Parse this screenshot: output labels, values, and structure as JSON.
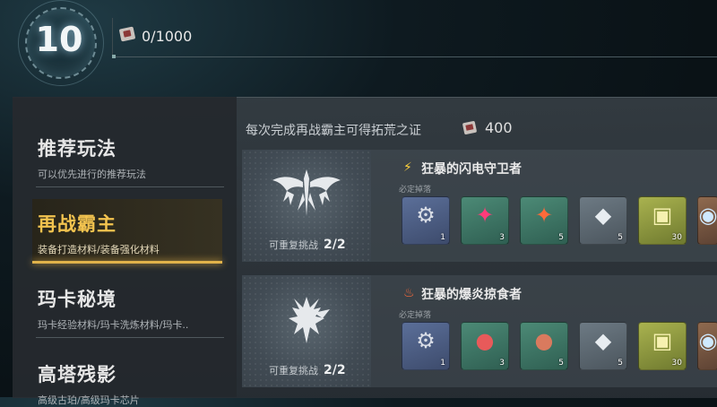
{
  "header": {
    "level": "10",
    "ticket_count": "0/1000"
  },
  "sidebar": {
    "items": [
      {
        "title": "推荐玩法",
        "subtitle": "可以优先进行的推荐玩法"
      },
      {
        "title": "再战霸主",
        "subtitle": "装备打造材料/装备强化材料"
      },
      {
        "title": "玛卡秘境",
        "subtitle": "玛卡经验材料/玛卡洗炼材料/玛卡.."
      },
      {
        "title": "高塔残影",
        "subtitle": "高级古珀/高级玛卡芯片"
      }
    ],
    "active_index": 1
  },
  "main": {
    "reward_info": "每次完成再战霸主可得拓荒之证",
    "reward_amount": "400",
    "bosses": [
      {
        "name": "狂暴的闪电守卫者",
        "element_icon": "lightning-icon",
        "drop_label": "必定掉落",
        "retry_label": "可重复挑战",
        "retry_value": "2/2",
        "drops": [
          {
            "icon": "claw-gear-icon",
            "quality": "blue",
            "qty": "1"
          },
          {
            "icon": "crystal-icon",
            "quality": "green",
            "qty": "3"
          },
          {
            "icon": "crystal-icon",
            "quality": "green",
            "qty": "5"
          },
          {
            "icon": "ore-icon",
            "quality": "gray",
            "qty": "5"
          },
          {
            "icon": "card-icon",
            "quality": "gold",
            "qty": "30"
          },
          {
            "icon": "chip-icon",
            "quality": "orange",
            "qty": ""
          }
        ]
      },
      {
        "name": "狂暴的爆炎掠食者",
        "element_icon": "fire-icon",
        "drop_label": "必定掉落",
        "retry_label": "可重复挑战",
        "retry_value": "2/2",
        "drops": [
          {
            "icon": "gauntlet-gear-icon",
            "quality": "blue",
            "qty": "1"
          },
          {
            "icon": "capsule-icon",
            "quality": "green",
            "qty": "3"
          },
          {
            "icon": "capsule-icon",
            "quality": "green",
            "qty": "5"
          },
          {
            "icon": "ore-icon",
            "quality": "gray",
            "qty": "5"
          },
          {
            "icon": "card-icon",
            "quality": "gold",
            "qty": "30"
          },
          {
            "icon": "chip-icon",
            "quality": "orange",
            "qty": ""
          }
        ]
      }
    ]
  }
}
